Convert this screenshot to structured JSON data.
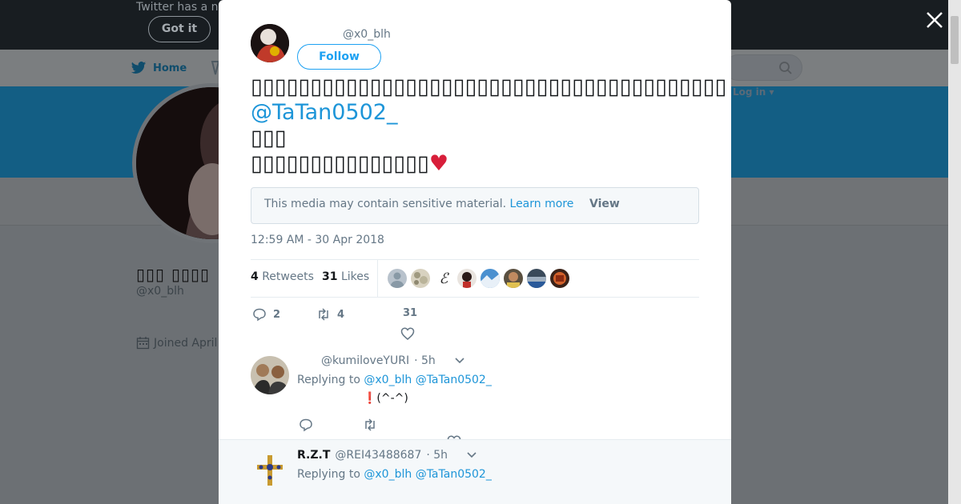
{
  "background": {
    "notice": "Twitter has a n",
    "got_it": "Got it",
    "nav_home": "Home",
    "login": "Log in ▾",
    "profile_name": "▯▯▯ ▯▯▯▯",
    "profile_handle": "@x0_blh",
    "joined": "Joined April"
  },
  "colors": {
    "link": "#1d95d8",
    "follow": "#1da1f2",
    "heart": "#d81e3a",
    "banner": "#135e84"
  },
  "modal": {
    "author_handle": "@x0_blh",
    "follow_label": "Follow",
    "tweet_line_1": "▯▯▯▯▯▯▯▯▯▯▯▯▯▯▯▯▯▯▯▯▯▯▯▯▯▯▯▯▯▯▯▯▯▯▯▯▯▯▯▯",
    "tweet_mention": "@TaTan0502_",
    "tweet_line_3": "▯▯▯",
    "tweet_line_4": "▯▯▯▯▯▯▯▯▯▯▯▯▯▯▯",
    "tweet_emoji": "♥",
    "sensitive_text": "This media may contain sensitive material.",
    "learn_more": "Learn more",
    "view_label": "View",
    "timestamp": "12:59 AM - 30 Apr 2018",
    "retweets_count": "4",
    "retweets_label": "Retweets",
    "likes_count": "31",
    "likes_label": "Likes",
    "actions": {
      "reply_count": "2",
      "retweet_count": "4",
      "like_count": "31"
    }
  },
  "replies": [
    {
      "handle": "@kumiloveYURI",
      "time": "· 5h",
      "replying_label": "Replying to",
      "mention_1": "@x0_blh",
      "mention_2": "@TaTan0502_",
      "body": "❗(^-^)"
    },
    {
      "name": "R.Z.T",
      "handle": "@REI43488687",
      "time": "· 5h",
      "replying_label": "Replying to",
      "mention_1": "@x0_blh",
      "mention_2": "@TaTan0502_"
    }
  ],
  "icons": [
    "twitter-bird-icon",
    "search-icon",
    "calendar-icon",
    "close-icon",
    "reply-icon",
    "retweet-icon",
    "heart-icon",
    "chevron-down-icon"
  ]
}
